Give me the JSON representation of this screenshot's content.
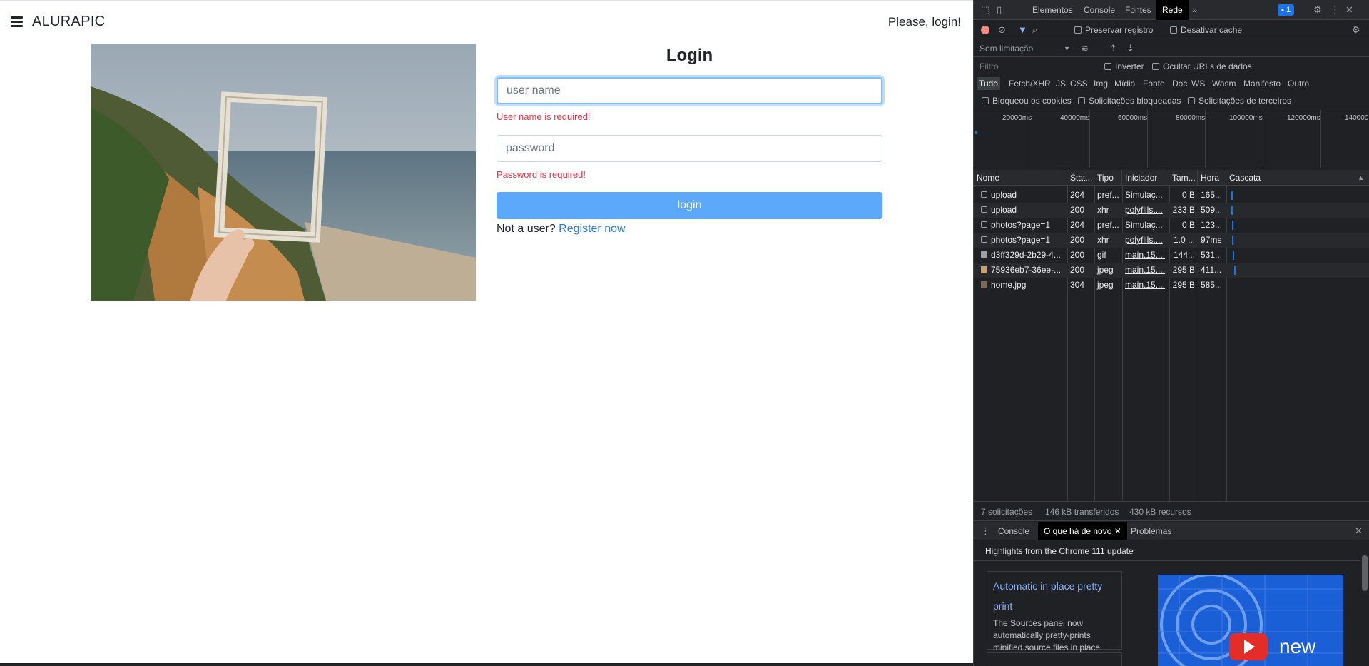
{
  "app": {
    "brand": "ALURAPIC",
    "login_prompt": "Please, login!",
    "login": {
      "title": "Login",
      "username_placeholder": "user name",
      "username_error": "User name is required!",
      "password_placeholder": "password",
      "password_error": "Password is required!",
      "submit_label": "login",
      "not_user_text": "Not a user?",
      "register_link": "Register now"
    }
  },
  "devtools": {
    "tabs": [
      "Elementos",
      "Console",
      "Fontes",
      "Rede"
    ],
    "active_tab": "Rede",
    "more_icon": "chevron-double-right-icon",
    "issues_badge": "1",
    "toolbar": {
      "preserve_log": "Preservar registro",
      "disable_cache": "Desativar cache",
      "throttling": "Sem limitação"
    },
    "filter": {
      "placeholder": "Filtro",
      "invert": "Inverter",
      "hide_data_urls": "Ocultar URLs de dados"
    },
    "type_filters": [
      "Tudo",
      "Fetch/XHR",
      "JS",
      "CSS",
      "Img",
      "Mídia",
      "Fonte",
      "Doc",
      "WS",
      "Wasm",
      "Manifesto",
      "Outro"
    ],
    "block_filters": [
      "Bloqueou os cookies",
      "Solicitações bloqueadas",
      "Solicitações de terceiros"
    ],
    "timeline_ticks": [
      "20000ms",
      "40000ms",
      "60000ms",
      "80000ms",
      "100000ms",
      "120000ms",
      "140000"
    ],
    "columns": [
      "Nome",
      "Stat...",
      "Tipo",
      "Iniciador",
      "Tam...",
      "Hora",
      "Cascata"
    ],
    "rows": [
      {
        "name": "upload",
        "status": "204",
        "type": "pref...",
        "initiator": "Simulaç...",
        "size": "0 B",
        "time": "165..."
      },
      {
        "name": "upload",
        "status": "200",
        "type": "xhr",
        "initiator": "polyfills....",
        "size": "233 B",
        "time": "509..."
      },
      {
        "name": "photos?page=1",
        "status": "204",
        "type": "pref...",
        "initiator": "Simulaç...",
        "size": "0 B",
        "time": "123..."
      },
      {
        "name": "photos?page=1",
        "status": "200",
        "type": "xhr",
        "initiator": "polyfills....",
        "size": "1.0 ...",
        "time": "97ms"
      },
      {
        "name": "d3ff329d-2b29-4...",
        "status": "200",
        "type": "gif",
        "initiator": "main.15....",
        "size": "144...",
        "time": "531..."
      },
      {
        "name": "75936eb7-36ee-...",
        "status": "200",
        "type": "jpeg",
        "initiator": "main.15....",
        "size": "295 B",
        "time": "411..."
      },
      {
        "name": "home.jpg",
        "status": "304",
        "type": "jpeg",
        "initiator": "main.15....",
        "size": "295 B",
        "time": "585..."
      }
    ],
    "status": {
      "requests": "7 solicitações",
      "transferred": "146 kB transferidos",
      "resources": "430 kB recursos"
    },
    "drawer": {
      "tabs": [
        "Console",
        "O que há de novo",
        "Problemas"
      ],
      "active_tab": "O que há de novo",
      "highlights_title": "Highlights from the Chrome 111 update",
      "card_title": "Automatic in place pretty print",
      "card_text": "The Sources panel now automatically pretty-prints minified source files in place.",
      "video_text": "new"
    }
  }
}
